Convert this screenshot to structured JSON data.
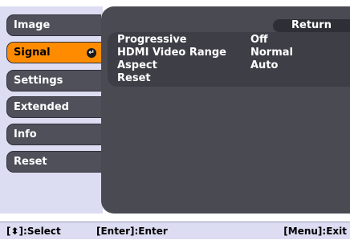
{
  "menu": {
    "items": [
      {
        "label": "Image"
      },
      {
        "label": "Signal",
        "active": true
      },
      {
        "label": "Settings"
      },
      {
        "label": "Extended"
      },
      {
        "label": "Info"
      },
      {
        "label": "Reset"
      }
    ]
  },
  "submenu": {
    "return_label": "Return",
    "rows": [
      {
        "label": "Progressive",
        "value": "Off"
      },
      {
        "label": "HDMI Video Range",
        "value": "Normal"
      },
      {
        "label": "Aspect",
        "value": "Auto"
      },
      {
        "label": "Reset",
        "value": ""
      }
    ]
  },
  "footer": {
    "select_hint": "[⬍]:Select",
    "enter_hint": "[Enter]:Enter",
    "exit_hint": "[Menu]:Exit"
  },
  "colors": {
    "accent": "#ff8c00",
    "panel": "#4a4a52",
    "sidebar": "#dcdcf2"
  }
}
